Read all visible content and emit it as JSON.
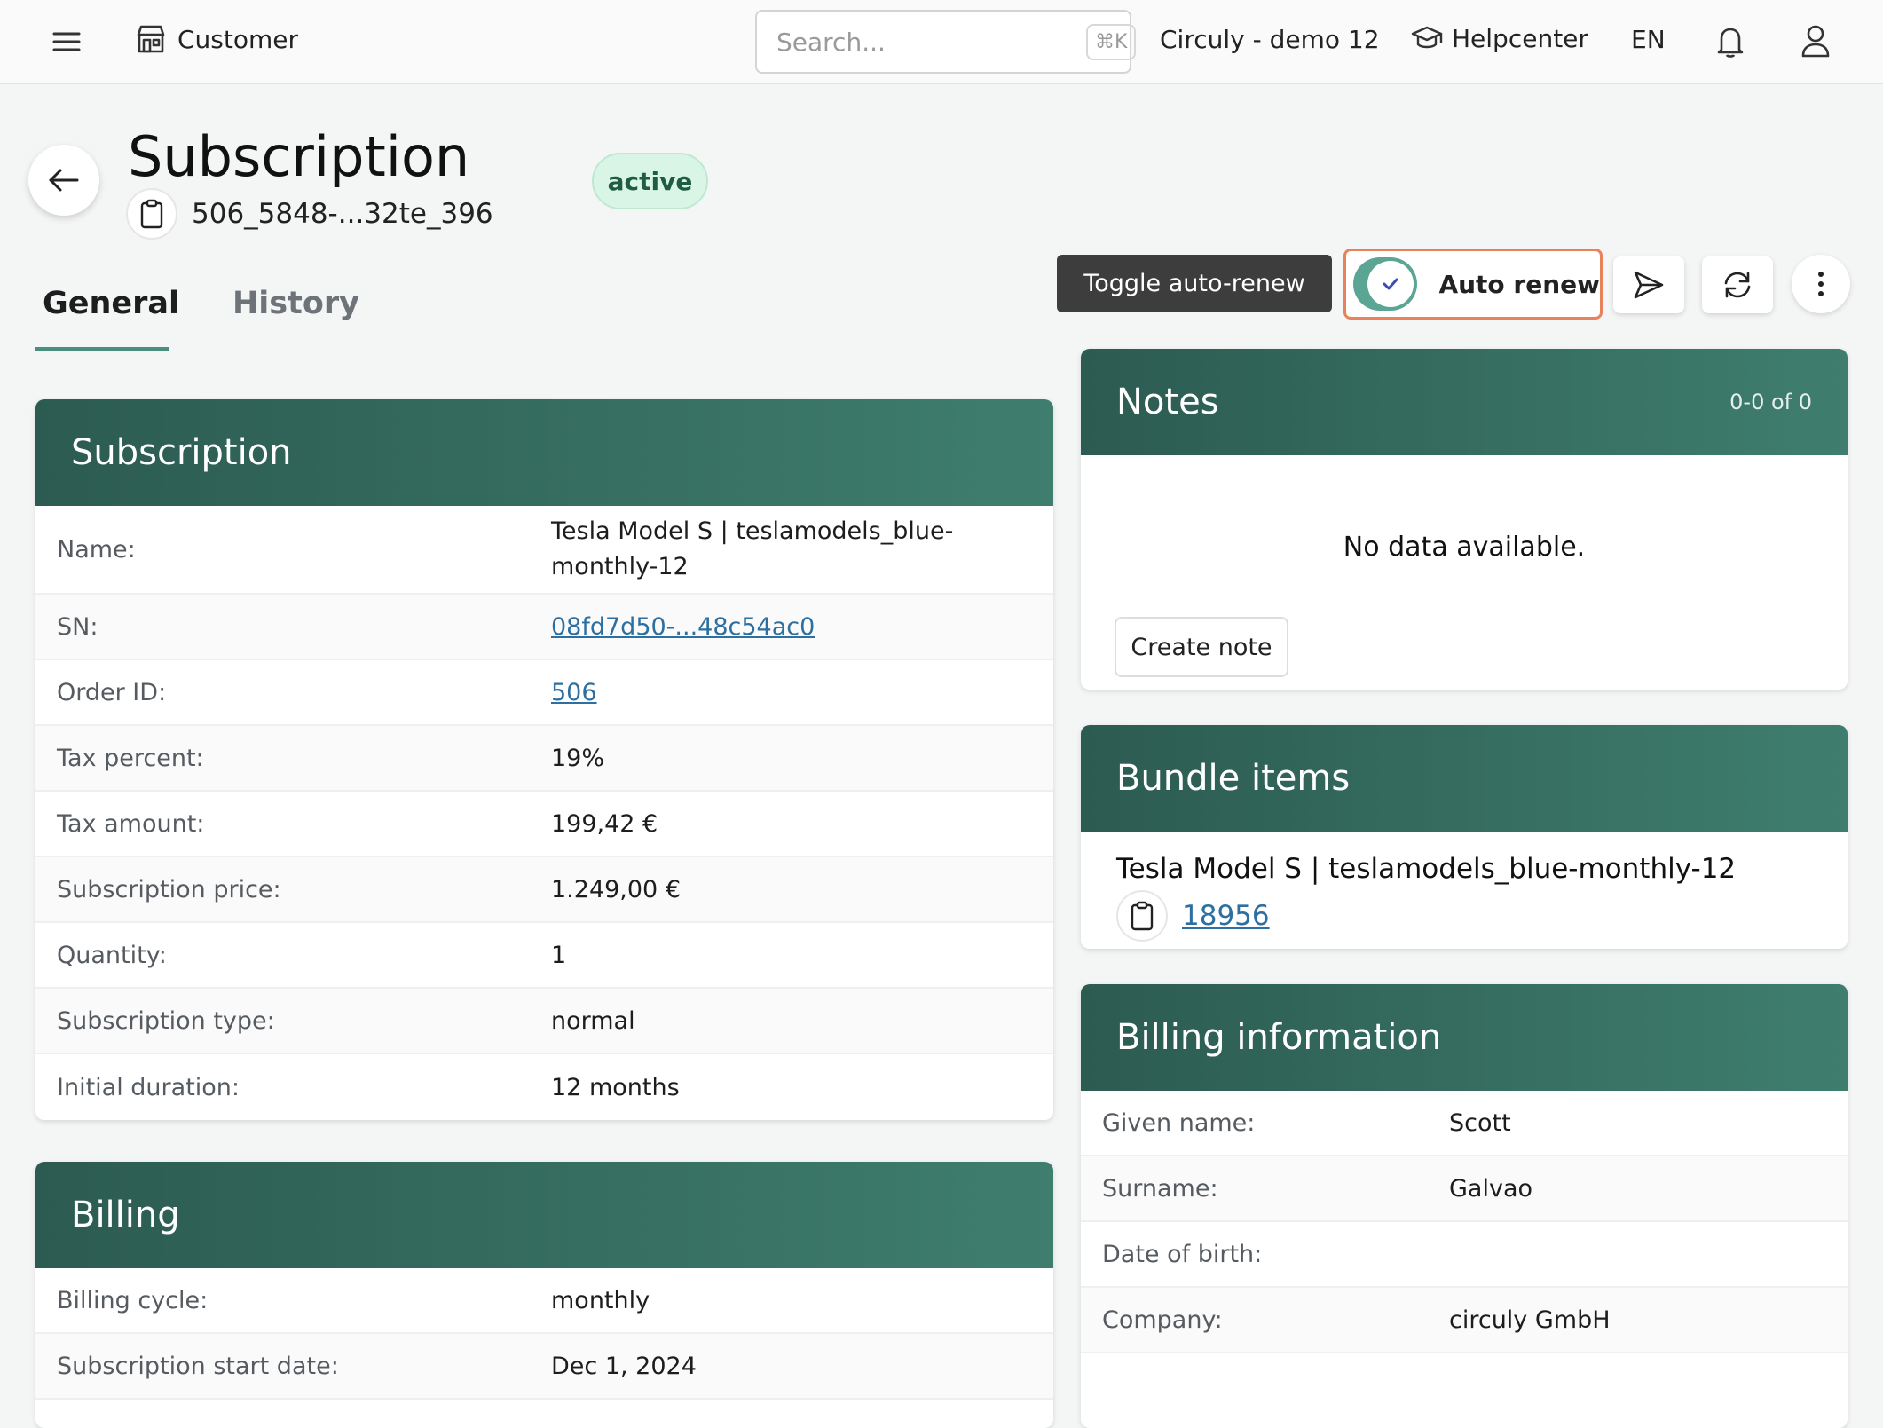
{
  "topbar": {
    "section_label": "Customer",
    "search_placeholder": "Search...",
    "search_shortcut": "⌘K",
    "workspace": "Circuly - demo 12",
    "helpcenter": "Helpcenter",
    "language": "EN"
  },
  "header": {
    "title": "Subscription",
    "subscription_id": "506_5848-...32te_396",
    "status": "active"
  },
  "tabs": [
    {
      "label": "General"
    },
    {
      "label": "History"
    }
  ],
  "actions": {
    "tooltip": "Toggle auto-renew",
    "auto_renew_label": "Auto renew"
  },
  "subscription_card": {
    "title": "Subscription",
    "rows": [
      {
        "label": "Name:",
        "value": "Tesla Model S | teslamodels_blue-monthly-12"
      },
      {
        "label": "SN:",
        "value": "08fd7d50-...48c54ac0"
      },
      {
        "label": "Order ID:",
        "value": "506"
      },
      {
        "label": "Tax percent:",
        "value": "19%"
      },
      {
        "label": "Tax amount:",
        "value": "199,42 €"
      },
      {
        "label": "Subscription price:",
        "value": "1.249,00 €"
      },
      {
        "label": "Quantity:",
        "value": "1"
      },
      {
        "label": "Subscription type:",
        "value": "normal"
      },
      {
        "label": "Initial duration:",
        "value": "12 months"
      }
    ]
  },
  "billing_card": {
    "title": "Billing",
    "rows": [
      {
        "label": "Billing cycle:",
        "value": "monthly"
      },
      {
        "label": "Subscription start date:",
        "value": "Dec 1, 2024"
      }
    ]
  },
  "notes_card": {
    "title": "Notes",
    "count": "0-0 of 0",
    "empty_text": "No data available.",
    "create_label": "Create note"
  },
  "bundle_card": {
    "title": "Bundle items",
    "item_name": "Tesla Model S | teslamodels_blue-monthly-12",
    "item_id": "18956"
  },
  "billing_info_card": {
    "title": "Billing information",
    "rows": [
      {
        "label": "Given name:",
        "value": "Scott"
      },
      {
        "label": "Surname:",
        "value": "Galvao"
      },
      {
        "label": "Date of birth:",
        "value": ""
      },
      {
        "label": "Company:",
        "value": "circuly GmbH"
      }
    ]
  },
  "colors": {
    "accent": "#3f7e6f",
    "card_header_dark": "#2c5b51",
    "status_bg": "#d9f5e6",
    "highlight_border": "#e8825a",
    "link": "#2c6fa0"
  }
}
